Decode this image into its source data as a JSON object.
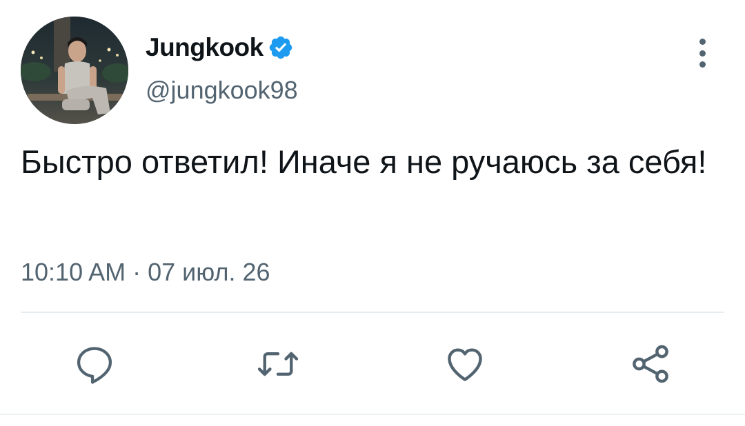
{
  "tweet": {
    "author": {
      "display_name": "Jungkook",
      "handle": "@jungkook98",
      "verified": true
    },
    "text": "Быстро ответил! Иначе я не ручаюсь за себя!",
    "timestamp": "10:10 AM · 07 июл. 26"
  },
  "actions": {
    "reply_icon": "reply-icon",
    "retweet_icon": "retweet-icon",
    "like_icon": "like-icon",
    "share_icon": "share-icon"
  },
  "colors": {
    "text_primary": "#0f1419",
    "text_secondary": "#536471",
    "verified_blue": "#1d9bf0",
    "divider": "#e6ecf0"
  }
}
